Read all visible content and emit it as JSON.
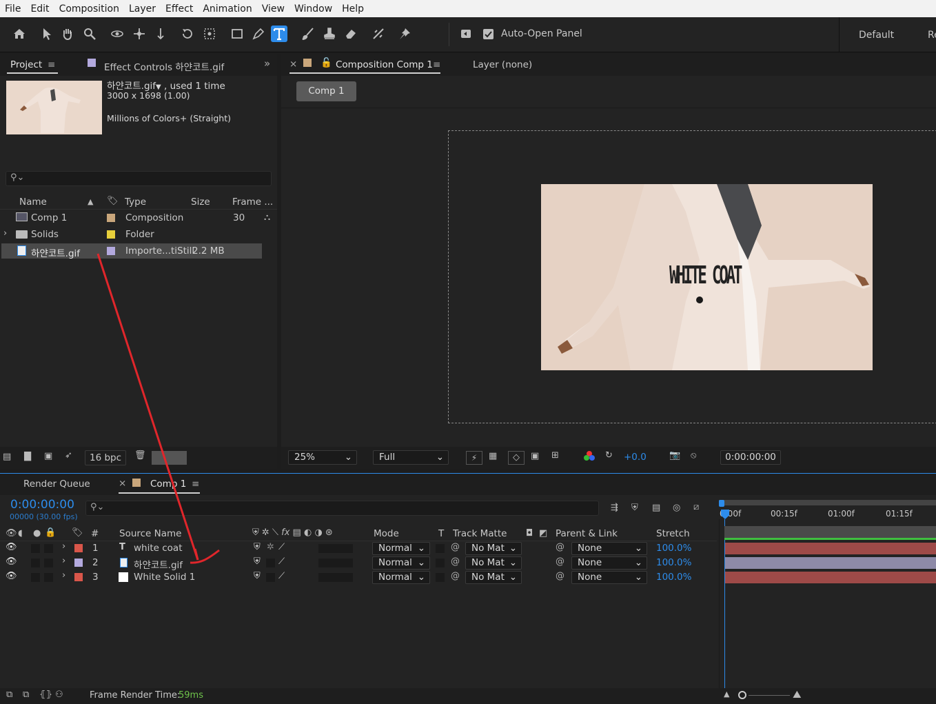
{
  "menu": [
    "File",
    "Edit",
    "Composition",
    "Layer",
    "Effect",
    "Animation",
    "View",
    "Window",
    "Help"
  ],
  "toolbar": {
    "tools": [
      "home-icon",
      "selection-arrow-icon",
      "hand-icon",
      "zoom-icon",
      "orbit-camera-icon",
      "pan-camera-icon",
      "dolly-camera-icon",
      "rotate-icon",
      "anchor-point-icon",
      "rectangle-icon",
      "pen-icon",
      "type-icon",
      "brush-icon",
      "clone-stamp-icon",
      "eraser-icon",
      "roto-brush-icon",
      "puppet-pin-icon"
    ],
    "active_tool": "type-icon",
    "auto_open_label": "Auto-Open Panel",
    "workspace_default": "Default",
    "workspace_next": "Re"
  },
  "project": {
    "tab_label": "Project",
    "effect_tab_label": "Effect Controls 하얀코트.gif",
    "info_name": "하얀코트.gif",
    "info_used": " , used 1 time",
    "info_dims": "3000 x 1698 (1.00)",
    "info_colors": "Millions of Colors+ (Straight)",
    "columns": {
      "name": "Name",
      "type": "Type",
      "size": "Size",
      "frame": "Frame ..."
    },
    "rows": [
      {
        "name": "Comp 1",
        "type": "Composition",
        "size": "",
        "frame": "30",
        "label_color": "#c9a67b"
      },
      {
        "name": "Solids",
        "type": "Folder",
        "size": "",
        "frame": "",
        "label_color": "#e7cf3b"
      },
      {
        "name": "하얀코트.gif",
        "type": "Importe...tiStill",
        "size": "2.2 MB",
        "frame": "",
        "label_color": "#b3a9de"
      }
    ],
    "bpc": "16 bpc"
  },
  "composition": {
    "tab_label": "Composition Comp 1",
    "layer_tab_label": "Layer (none)",
    "comp_button": "Comp 1",
    "overlay_text": "WHITE COAT",
    "zoom": "25%",
    "resolution": "Full",
    "exposure": "+0.0",
    "timecode": "0:00:00:00"
  },
  "timeline": {
    "render_queue_tab": "Render Queue",
    "comp_tab": "Comp 1",
    "timecode": "0:00:00:00",
    "frames_fps": "00000 (30.00 fps)",
    "ruler": [
      "0:00f",
      "00:15f",
      "01:00f",
      "01:15f"
    ],
    "columns": {
      "num": "#",
      "source": "Source Name",
      "mode": "Mode",
      "t": "T",
      "track_matte": "Track Matte",
      "parent": "Parent & Link",
      "stretch": "Stretch"
    },
    "layers": [
      {
        "num": "1",
        "name": "white coat",
        "mode": "Normal",
        "matte": "No Mat",
        "parent": "None",
        "stretch": "100.0%",
        "label_color": "#d9564a",
        "bar_color": "#9e4a48"
      },
      {
        "num": "2",
        "name": "하얀코트.gif",
        "mode": "Normal",
        "matte": "No Mat",
        "parent": "None",
        "stretch": "100.0%",
        "label_color": "#b3a9de",
        "bar_color": "#8e8aa8"
      },
      {
        "num": "3",
        "name": "White Solid 1",
        "mode": "Normal",
        "matte": "No Mat",
        "parent": "None",
        "stretch": "100.0%",
        "label_color": "#d9564a",
        "bar_color": "#9e4a48"
      }
    ],
    "render_time_label": "Frame Render Time:",
    "render_time_value": "59ms"
  },
  "colors": {
    "accent": "#2d8ceb",
    "annotation_arrow": "#e0262b"
  }
}
